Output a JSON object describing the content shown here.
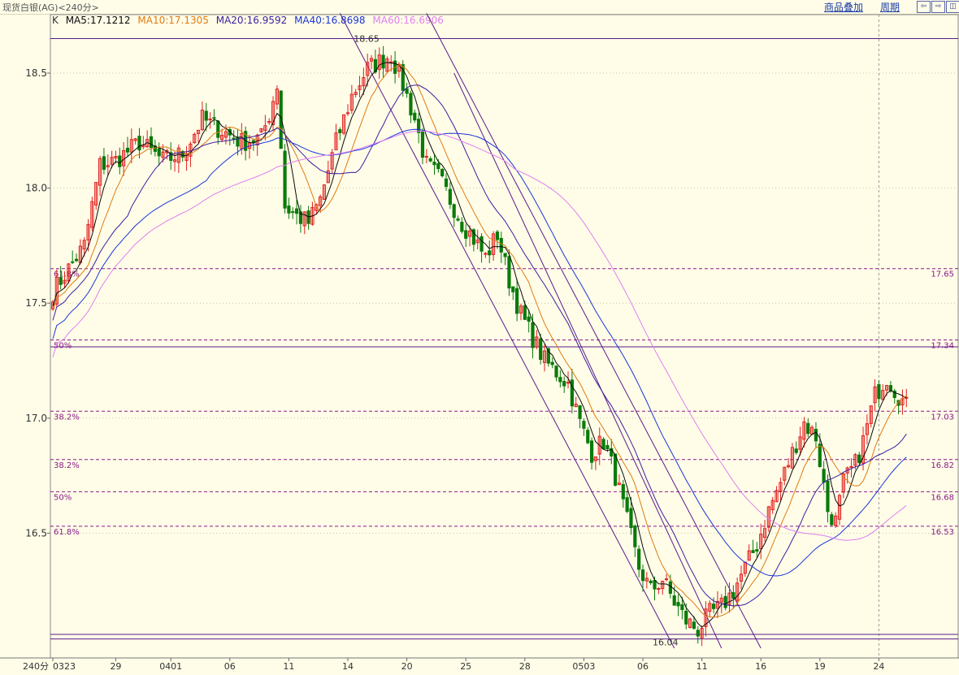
{
  "header": {
    "title": "现货白银(AG)<240分>",
    "links": [
      "商品叠加",
      "周期"
    ],
    "nav_buttons": [
      "⇦",
      "⇨",
      "◫"
    ]
  },
  "legend": {
    "prefix": "K",
    "items": [
      {
        "label": "MA5:17.1212",
        "color": "#0a0a0a"
      },
      {
        "label": "MA10:17.1305",
        "color": "#e07a10"
      },
      {
        "label": "MA20:16.9592",
        "color": "#3a1ea0"
      },
      {
        "label": "MA40:16.8698",
        "color": "#1a35d8"
      },
      {
        "label": "MA60:16.6906",
        "color": "#e07ff0"
      }
    ]
  },
  "colors": {
    "up": "#e02020",
    "down": "#0a7a0a",
    "grid": "#c8c4a0",
    "fib": "#8a1a8a",
    "channel": "#5a1a8a",
    "ma5": "#0a0a0a",
    "ma10": "#e07a10",
    "ma20": "#3a1ea0",
    "ma40": "#1a35d8",
    "ma60": "#e07ff0"
  },
  "chart_data": {
    "type": "candlestick",
    "title": "现货白银(AG)<240分>",
    "interval_label": "240分",
    "ylim": [
      15.95,
      18.75
    ],
    "y_ticks": [
      16.5,
      17.0,
      17.5,
      18.0,
      18.5
    ],
    "y_tick_labels": [
      "16.5",
      "17.0",
      "17.5",
      "18.0",
      "18.5"
    ],
    "x_ticks": [
      {
        "label": "0323",
        "bar": 0
      },
      {
        "label": "29",
        "bar": 16
      },
      {
        "label": "0401",
        "bar": 30
      },
      {
        "label": "06",
        "bar": 45
      },
      {
        "label": "11",
        "bar": 60
      },
      {
        "label": "14",
        "bar": 75
      },
      {
        "label": "20",
        "bar": 90
      },
      {
        "label": "25",
        "bar": 105
      },
      {
        "label": "28",
        "bar": 120
      },
      {
        "label": "0503",
        "bar": 135
      },
      {
        "label": "06",
        "bar": 150
      },
      {
        "label": "11",
        "bar": 165
      },
      {
        "label": "16",
        "bar": 180
      },
      {
        "label": "19",
        "bar": 195
      },
      {
        "label": "24",
        "bar": 210
      }
    ],
    "anchors": [
      [
        0,
        17.55
      ],
      [
        8,
        17.75
      ],
      [
        12,
        18.1
      ],
      [
        16,
        18.12
      ],
      [
        22,
        18.2
      ],
      [
        28,
        18.12
      ],
      [
        33,
        18.15
      ],
      [
        38,
        18.3
      ],
      [
        43,
        18.25
      ],
      [
        48,
        18.2
      ],
      [
        53,
        18.22
      ],
      [
        55,
        18.32
      ],
      [
        57,
        18.45
      ],
      [
        59,
        17.92
      ],
      [
        62,
        17.88
      ],
      [
        65,
        17.85
      ],
      [
        68,
        17.95
      ],
      [
        72,
        18.2
      ],
      [
        76,
        18.4
      ],
      [
        80,
        18.52
      ],
      [
        83,
        18.55
      ],
      [
        86,
        18.58
      ],
      [
        89,
        18.45
      ],
      [
        92,
        18.3
      ],
      [
        95,
        18.1
      ],
      [
        98,
        18.05
      ],
      [
        101,
        17.95
      ],
      [
        104,
        17.85
      ],
      [
        107,
        17.78
      ],
      [
        110,
        17.7
      ],
      [
        113,
        17.8
      ],
      [
        116,
        17.6
      ],
      [
        119,
        17.45
      ],
      [
        122,
        17.35
      ],
      [
        125,
        17.25
      ],
      [
        128,
        17.2
      ],
      [
        131,
        17.15
      ],
      [
        134,
        16.98
      ],
      [
        137,
        16.85
      ],
      [
        140,
        16.9
      ],
      [
        143,
        16.75
      ],
      [
        146,
        16.55
      ],
      [
        149,
        16.35
      ],
      [
        152,
        16.25
      ],
      [
        155,
        16.3
      ],
      [
        158,
        16.2
      ],
      [
        161,
        16.12
      ],
      [
        164,
        16.08
      ],
      [
        167,
        16.15
      ],
      [
        170,
        16.18
      ],
      [
        173,
        16.25
      ],
      [
        176,
        16.35
      ],
      [
        179,
        16.45
      ],
      [
        182,
        16.6
      ],
      [
        185,
        16.72
      ],
      [
        188,
        16.85
      ],
      [
        191,
        16.98
      ],
      [
        194,
        16.92
      ],
      [
        197,
        16.6
      ],
      [
        199,
        16.55
      ],
      [
        201,
        16.72
      ],
      [
        204,
        16.8
      ],
      [
        206,
        16.9
      ],
      [
        209,
        17.1
      ],
      [
        212,
        17.18
      ],
      [
        215,
        17.1
      ],
      [
        217,
        17.05
      ]
    ],
    "series": [
      {
        "name": "MA5",
        "value": 17.1212,
        "period": 5
      },
      {
        "name": "MA10",
        "value": 17.1305,
        "period": 10
      },
      {
        "name": "MA20",
        "value": 16.9592,
        "period": 20
      },
      {
        "name": "MA40",
        "value": 16.8698,
        "period": 40
      },
      {
        "name": "MA60",
        "value": 16.6906,
        "period": 60
      }
    ],
    "fib_levels": [
      {
        "left": "61.8%",
        "right": "17.65",
        "price": 17.65
      },
      {
        "left": "50%",
        "right": "17.34",
        "price": 17.34
      },
      {
        "left": "38.2%",
        "right": "17.03",
        "price": 17.03
      },
      {
        "left": "38.2%",
        "right": "16.82",
        "price": 16.82
      },
      {
        "left": "50%",
        "right": "16.68",
        "price": 16.68
      },
      {
        "left": "61.8%",
        "right": "16.53",
        "price": 16.53
      }
    ],
    "solid_levels": [
      18.65,
      17.31,
      16.06,
      16.04
    ],
    "annotations": [
      {
        "text": "18.65",
        "bar": 83,
        "price": 18.65
      },
      {
        "text": "16.04",
        "bar": 159,
        "price": 16.04
      }
    ],
    "channel_lines": [
      [
        [
          73,
          18.76
        ],
        [
          158,
          16.0
        ]
      ],
      [
        [
          95,
          18.76
        ],
        [
          180,
          16.0
        ]
      ],
      [
        [
          102,
          18.5
        ],
        [
          170,
          16.0
        ]
      ]
    ],
    "bar_count": 218
  }
}
